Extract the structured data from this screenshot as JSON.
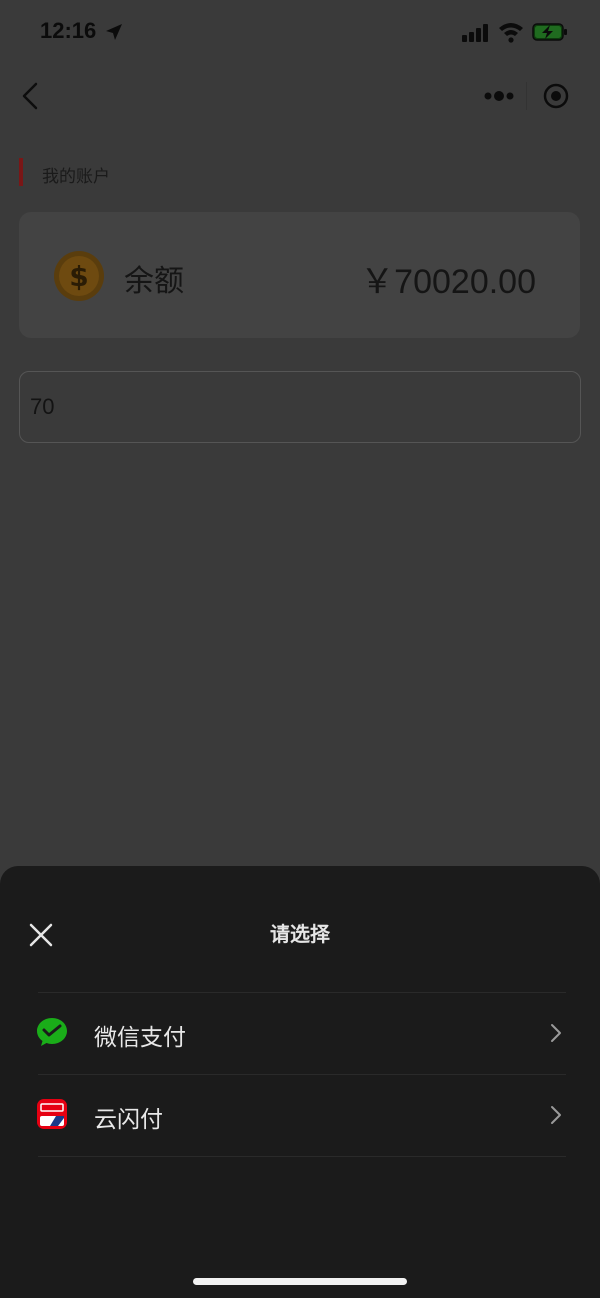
{
  "status_bar": {
    "time": "12:16"
  },
  "page": {
    "section_title": "我的账户",
    "balance_label": "余额",
    "balance_amount": "￥70020.00",
    "amount_input_value": "70"
  },
  "sheet": {
    "title": "请选择",
    "options": [
      {
        "label": "微信支付",
        "icon": "wechat-pay-icon"
      },
      {
        "label": "云闪付",
        "icon": "unionpay-quickpass-icon"
      }
    ]
  },
  "colors": {
    "overlay_background": "#3a3a3a",
    "sheet_background": "#1b1b1b",
    "wechat_green": "#1aad19",
    "unionpay_red": "#e60012",
    "section_marker": "#7a1616"
  }
}
